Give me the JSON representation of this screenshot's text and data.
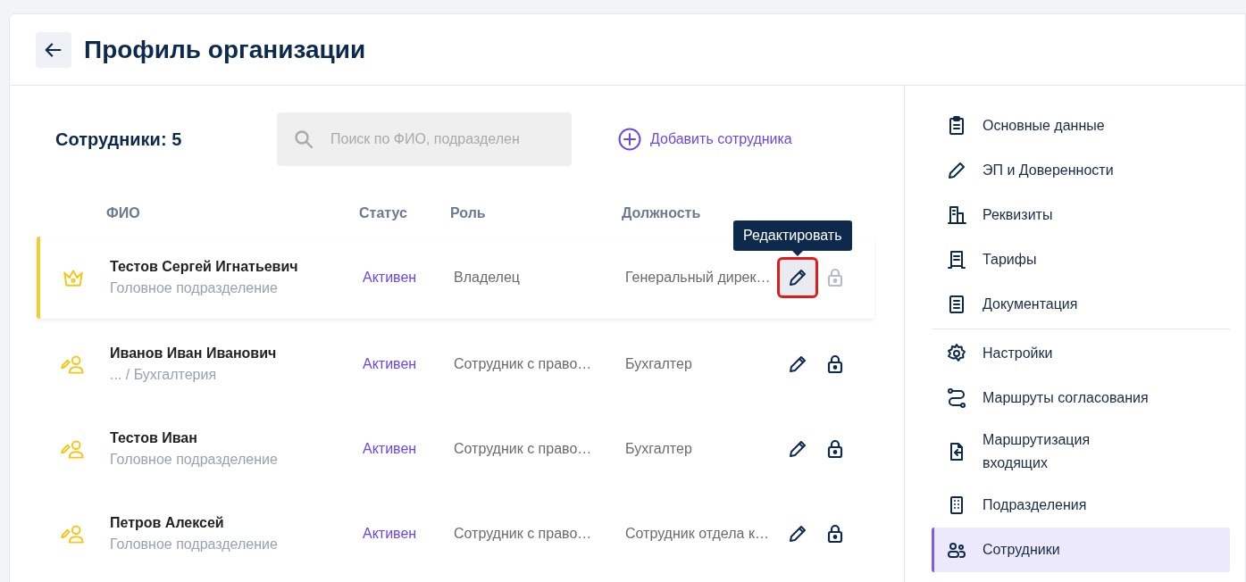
{
  "header": {
    "title": "Профиль организации"
  },
  "toolbar": {
    "count_label": "Сотрудники: 5",
    "search": {
      "placeholder": "Поиск по ФИО, подразделен"
    },
    "add_button": "Добавить сотрудника"
  },
  "table": {
    "columns": [
      "ФИО",
      "Статус",
      "Роль",
      "Должность"
    ],
    "rows": [
      {
        "kind": "owner",
        "selected": true,
        "name": "Тестов Сергей Игнатьевич",
        "department": "Головное подразделение",
        "status": "Активен",
        "role": "Владелец",
        "position": "Генеральный дирек…",
        "edit_highlighted": true,
        "edit_tooltip": "Редактировать",
        "lock_disabled": true
      },
      {
        "kind": "employee",
        "selected": false,
        "name": "Иванов Иван Иванович",
        "department": "... / Бухгалтерия",
        "status": "Активен",
        "role": "Сотрудник с право…",
        "position": "Бухгалтер",
        "edit_highlighted": false,
        "lock_disabled": false
      },
      {
        "kind": "employee",
        "selected": false,
        "name": "Тестов Иван",
        "department": "Головное подразделение",
        "status": "Активен",
        "role": "Сотрудник с право…",
        "position": "Бухгалтер",
        "edit_highlighted": false,
        "lock_disabled": false
      },
      {
        "kind": "employee",
        "selected": false,
        "name": "Петров Алексей",
        "department": "Головное подразделение",
        "status": "Активен",
        "role": "Сотрудник с право…",
        "position": "Сотрудник отдела к…",
        "edit_highlighted": false,
        "lock_disabled": false
      }
    ]
  },
  "sidebar": {
    "items": [
      {
        "kind": "clipboard",
        "label": "Основные данные",
        "selected": false
      },
      {
        "kind": "pen",
        "label": "ЭП и Доверенности",
        "selected": false
      },
      {
        "kind": "building",
        "label": "Реквизиты",
        "selected": false
      },
      {
        "kind": "receipt",
        "label": "Тарифы",
        "selected": false
      },
      {
        "kind": "document",
        "label": "Документация",
        "selected": false,
        "divider_after": true
      },
      {
        "kind": "gear",
        "label": "Настройки",
        "selected": false
      },
      {
        "kind": "route",
        "label": "Маршруты согласования",
        "selected": false
      },
      {
        "kind": "file-in",
        "label": "Маршрутизация входящих",
        "selected": false
      },
      {
        "kind": "office",
        "label": "Подразделения",
        "selected": false
      },
      {
        "kind": "people",
        "label": "Сотрудники",
        "selected": true
      }
    ]
  }
}
